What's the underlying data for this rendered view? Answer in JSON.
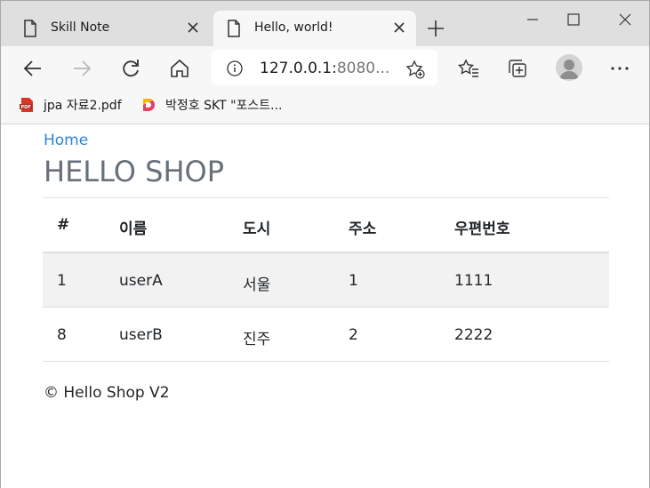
{
  "tabs": [
    {
      "title": "Skill Note",
      "active": false
    },
    {
      "title": "Hello, world!",
      "active": true
    }
  ],
  "address": {
    "host": "127.0.0.1:",
    "port": "8080..."
  },
  "bookmarks": [
    {
      "label": "jpa 자료2.pdf",
      "icon": "pdf-icon"
    },
    {
      "label": "박정호 SKT \"포스트...",
      "icon": "d-logo-icon"
    }
  ],
  "page": {
    "home_link": "Home",
    "title": "HELLO SHOP",
    "table": {
      "headers": [
        "#",
        "이름",
        "도시",
        "주소",
        "우편번호"
      ],
      "rows": [
        [
          "1",
          "userA",
          "서울",
          "1",
          "1111"
        ],
        [
          "8",
          "userB",
          "진주",
          "2",
          "2222"
        ]
      ]
    },
    "footer": "© Hello Shop V2"
  },
  "colors": {
    "link": "#2d85d8",
    "title": "#67707a",
    "stripe": "#f2f2f2"
  }
}
